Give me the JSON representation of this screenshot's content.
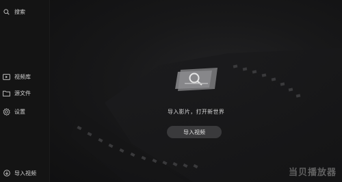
{
  "sidebar": {
    "search_label": "搜索",
    "items": [
      {
        "label": "视频库",
        "icon": "video-library-icon"
      },
      {
        "label": "源文件",
        "icon": "folder-icon"
      },
      {
        "label": "设置",
        "icon": "gear-icon"
      }
    ],
    "import_label": "导入视频"
  },
  "main": {
    "empty_message": "导入影片，打开新世界",
    "import_button_label": "导入视频"
  },
  "watermark": "当贝播放器",
  "colors": {
    "background": "#0f0f10",
    "sidebar": "#141414",
    "button": "#3a3a3c"
  }
}
